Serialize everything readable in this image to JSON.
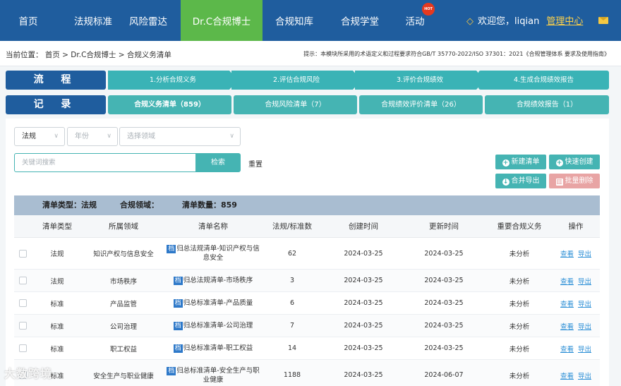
{
  "nav": {
    "items": [
      "首页",
      "法规标准",
      "风险雷达",
      "Dr.C合规博士",
      "合规知库",
      "合规学堂",
      "活动"
    ],
    "active": "Dr.C合规博士",
    "hot_badge": "HOT",
    "welcome": "欢迎您，",
    "username": "liqian",
    "management_link": "管理中心"
  },
  "breadcrumb": "当前位置： 首页 > Dr.C合规博士 > 合规义务清单",
  "hint": "提示：本模块所采用的术语定义和过程要求符合GB/T 35770-2022/ISO 37301：2021《合规管理体系 要求及使用指南》",
  "process": {
    "label": "流 程",
    "steps": [
      "1.分析合规义务",
      "2.评估合规风险",
      "3.评价合规绩效",
      "4.生成合规绩效报告"
    ]
  },
  "records": {
    "label": "记 录",
    "tabs": [
      "合规义务清单（859）",
      "合规风险清单（7）",
      "合规绩效评价清单（26）",
      "合规绩效报告（1）"
    ]
  },
  "filters": {
    "type_value": "法规",
    "year_placeholder": "年份",
    "domain_placeholder": "选择领域",
    "search_placeholder": "关键词搜索",
    "search_button": "检索",
    "reset": "重置"
  },
  "actions": {
    "new": "新建清单",
    "quick_create": "快速创建",
    "merge_export": "合并导出",
    "batch_delete": "批量删除"
  },
  "summary": {
    "type": "清单类型：法规",
    "domain": "合规领域：",
    "count": "清单数量：859"
  },
  "table": {
    "headers": [
      "清单类型",
      "所属领域",
      "清单名称",
      "法规/标准数",
      "创建时间",
      "更新时间",
      "重要合规义务",
      "操作"
    ],
    "tag": "档",
    "view": "查看",
    "export": "导出",
    "rows": [
      {
        "type": "法规",
        "domain": "知识产权与信息安全",
        "name": "归总法规清单-知识产权与信息安全",
        "count": "62",
        "created": "2024-03-25",
        "updated": "2024-03-25",
        "important": "未分析"
      },
      {
        "type": "法规",
        "domain": "市场秩序",
        "name": "归总法规清单-市场秩序",
        "count": "3",
        "created": "2024-03-25",
        "updated": "2024-03-25",
        "important": "未分析"
      },
      {
        "type": "标准",
        "domain": "产品监管",
        "name": "归总标准清单-产品质量",
        "count": "6",
        "created": "2024-03-25",
        "updated": "2024-03-25",
        "important": "未分析"
      },
      {
        "type": "标准",
        "domain": "公司治理",
        "name": "归总标准清单-公司治理",
        "count": "7",
        "created": "2024-03-25",
        "updated": "2024-03-25",
        "important": "未分析"
      },
      {
        "type": "标准",
        "domain": "职工权益",
        "name": "归总标准清单-职工权益",
        "count": "14",
        "created": "2024-03-25",
        "updated": "2024-03-25",
        "important": "未分析"
      },
      {
        "type": "标准",
        "domain": "安全生产与职业健康",
        "name": "归总标准清单-安全生产与职业健康",
        "count": "1188",
        "created": "2024-03-25",
        "updated": "2024-06-07",
        "important": "未分析"
      }
    ]
  },
  "watermark": "大数跨境"
}
